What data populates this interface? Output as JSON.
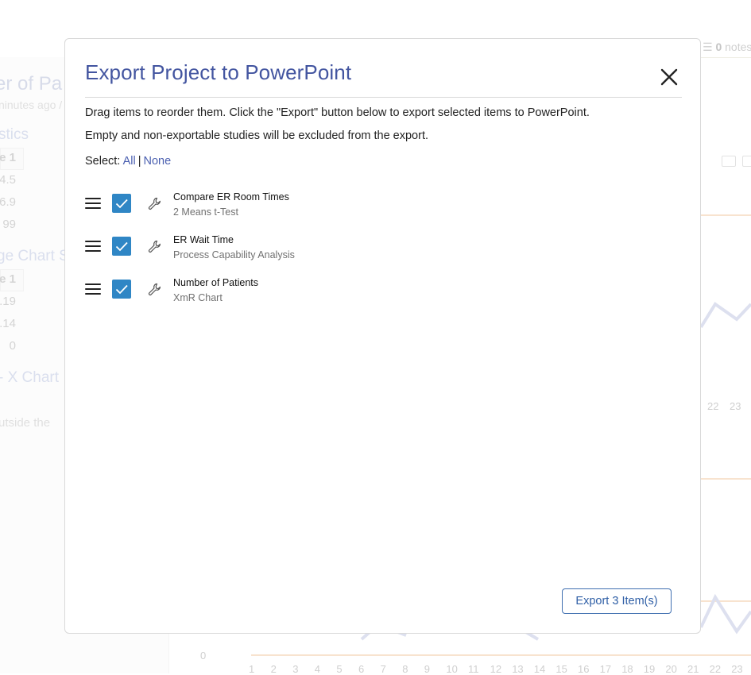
{
  "background": {
    "notes": {
      "count": "0",
      "label": "notes"
    },
    "title_fragment": "er of Pa",
    "subtitle_fragment": "ninutes ago /",
    "section1": "stics",
    "cells1": [
      "e 1",
      "4.5",
      "6.9",
      "99"
    ],
    "section2": "ge Chart S",
    "cells2": [
      "e 1",
      ".19",
      ".14",
      "0"
    ],
    "section3": "- X Chart",
    "note_fragment": "utside the",
    "axis_top_ticks": [
      "22",
      "23"
    ],
    "axis_zero": "0",
    "x_ticks": [
      "1",
      "2",
      "3",
      "4",
      "5",
      "6",
      "7",
      "8",
      "9",
      "10",
      "11",
      "12",
      "13",
      "14",
      "15",
      "16",
      "17",
      "18",
      "19",
      "20",
      "21",
      "22",
      "23"
    ]
  },
  "modal": {
    "title": "Export Project to PowerPoint",
    "close_icon": "close-icon",
    "instructions": "Drag items to reorder them. Click the \"Export\" button below to export selected items to PowerPoint.",
    "note": "Empty and non-exportable studies will be excluded from the export.",
    "select_label": "Select:",
    "select_all": "All",
    "select_separator": "|",
    "select_none": "None",
    "items": [
      {
        "title": "Compare ER Room Times",
        "subtitle": "2 Means t-Test",
        "checked": true,
        "icon": "wrench-icon"
      },
      {
        "title": "ER Wait Time",
        "subtitle": "Process Capability Analysis",
        "checked": true,
        "icon": "wrench-icon"
      },
      {
        "title": "Number of Patients",
        "subtitle": "XmR Chart",
        "checked": true,
        "icon": "wrench-icon"
      }
    ],
    "export_button": "Export 3 Item(s)"
  },
  "colors": {
    "title": "#4355a0",
    "checkbox": "#2f86c5",
    "link": "#4a5fb0",
    "button_border": "#3f6fb0"
  }
}
